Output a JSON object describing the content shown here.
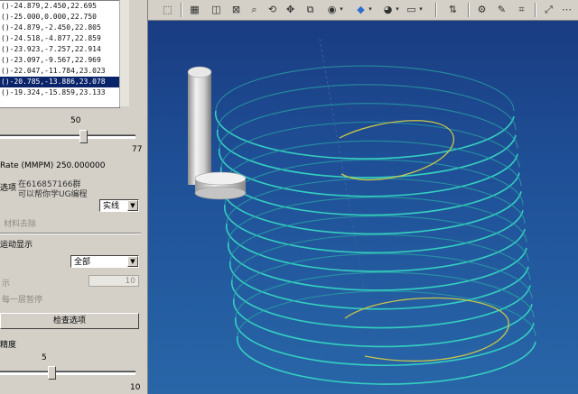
{
  "coords": {
    "rows": [
      "()-24.879,2.450,22.695",
      "()-25.000,0.000,22.750",
      "()-24.879,-2.450,22.805",
      "()-24.518,-4.877,22.859",
      "()-23.923,-7.257,22.914",
      "()-23.097,-9.567,22.969",
      "()-22.047,-11.784,23.023",
      "()-20.785,-13.886,23.078",
      "()-19.324,-15.859,23.133"
    ],
    "selected_index": 7
  },
  "speed_slider": {
    "value": 50,
    "max": 77,
    "level": 0.65
  },
  "feed_rate": "Rate (MMPM) 250.000000",
  "options": {
    "heading": "选项",
    "promo_line1": "在616857166群",
    "promo_line2": "可以帮你学UG编程",
    "display_mode": "实线",
    "material_removal": "材料去除"
  },
  "animation": {
    "heading": "运动显示",
    "dropdown_value": "全部",
    "field_label": "示",
    "field_value": "10",
    "pause_label": "每一层暂停"
  },
  "check_button_label": "检查选项",
  "accuracy": {
    "heading": "精度",
    "value": 5,
    "max": 10,
    "level": 0.5
  },
  "toolbar": {
    "icons": [
      "select-icon",
      "grid-icon",
      "zoom-window-icon",
      "zoom-icon",
      "rotate-icon",
      "pan-icon",
      "fit-icon",
      "render-mode-icon",
      "view-cube-icon",
      "shading-icon",
      "clipping-icon",
      "layer-icon",
      "measure-icon",
      "analysis-icon",
      "snap-icon",
      "options-icon"
    ]
  },
  "colors": {
    "viewport_top": "#1a3c82",
    "viewport_bottom": "#2866a8",
    "toolpath": "#35cfc0",
    "highlight_path": "#c6c64a",
    "list_selection": "#0a246a"
  }
}
